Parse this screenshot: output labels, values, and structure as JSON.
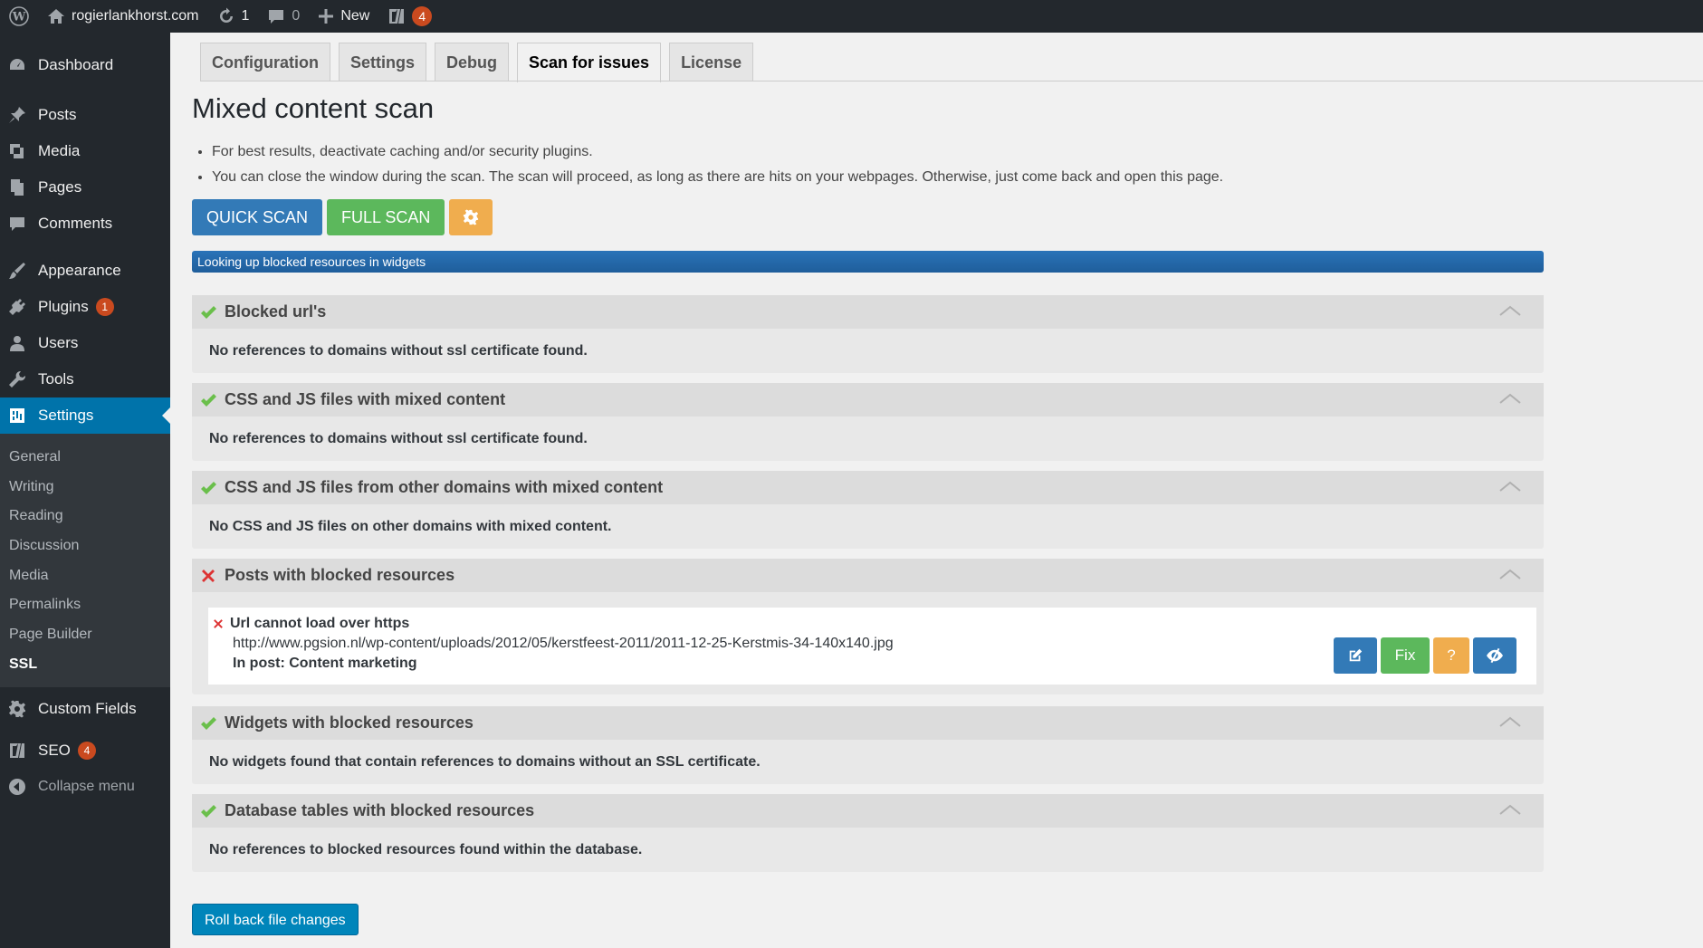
{
  "adminbar": {
    "site_name": "rogierlankhorst.com",
    "updates_count": "1",
    "comments_count": "0",
    "new_label": "New",
    "seo_count": "4"
  },
  "sidebar": {
    "items": [
      {
        "label": "Dashboard",
        "icon": "dashboard-icon"
      },
      {
        "label": "Posts",
        "icon": "pin-icon"
      },
      {
        "label": "Media",
        "icon": "media-icon"
      },
      {
        "label": "Pages",
        "icon": "pages-icon"
      },
      {
        "label": "Comments",
        "icon": "comment-icon"
      },
      {
        "label": "Appearance",
        "icon": "brush-icon"
      },
      {
        "label": "Plugins",
        "icon": "plug-icon",
        "badge": "1"
      },
      {
        "label": "Users",
        "icon": "user-icon"
      },
      {
        "label": "Tools",
        "icon": "wrench-icon"
      },
      {
        "label": "Settings",
        "icon": "settings-icon"
      }
    ],
    "submenu": [
      "General",
      "Writing",
      "Reading",
      "Discussion",
      "Media",
      "Permalinks",
      "Page Builder",
      "SSL"
    ],
    "after": [
      {
        "label": "Custom Fields",
        "icon": "gear-icon"
      },
      {
        "label": "SEO",
        "icon": "seo-icon",
        "badge": "4"
      }
    ],
    "collapse_label": "Collapse menu"
  },
  "tabs": [
    "Configuration",
    "Settings",
    "Debug",
    "Scan for issues",
    "License"
  ],
  "page_title": "Mixed content scan",
  "notes": [
    "For best results, deactivate caching and/or security plugins.",
    "You can close the window during the scan. The scan will proceed, as long as there are hits on your webpages. Otherwise, just come back and open this page."
  ],
  "buttons": {
    "quick_scan": "QUICK SCAN",
    "full_scan": "FULL SCAN"
  },
  "progress": {
    "label": "Looking up blocked resources in widgets",
    "percent": 100
  },
  "panels": [
    {
      "title": "Blocked url's",
      "status": "ok",
      "message": "No references to domains without ssl certificate found."
    },
    {
      "title": "CSS and JS files with mixed content",
      "status": "ok",
      "message": "No references to domains without ssl certificate found."
    },
    {
      "title": "CSS and JS files from other domains with mixed content",
      "status": "ok",
      "message": "No CSS and JS files on other domains with mixed content."
    },
    {
      "title": "Posts with blocked resources",
      "status": "error",
      "message": ""
    },
    {
      "title": "Widgets with blocked resources",
      "status": "ok",
      "message": "No widgets found that contain references to domains without an SSL certificate."
    },
    {
      "title": "Database tables with blocked resources",
      "status": "ok",
      "message": "No references to blocked resources found within the database."
    }
  ],
  "issue": {
    "title": "Url cannot load over https",
    "url": "http://www.pgsion.nl/wp-content/uploads/2012/05/kerstfeest-2011/2011-12-25-Kerstmis-34-140x140.jpg",
    "post": "In post: Content marketing",
    "fix_label": "Fix",
    "help_label": "?"
  },
  "rollback_label": "Roll back file changes",
  "colors": {
    "ok": "#6abf4b",
    "error": "#dd3333",
    "primary": "#337ab7",
    "success": "#5cb85c",
    "warning": "#f0ad4e",
    "wp_blue": "#0073aa"
  }
}
